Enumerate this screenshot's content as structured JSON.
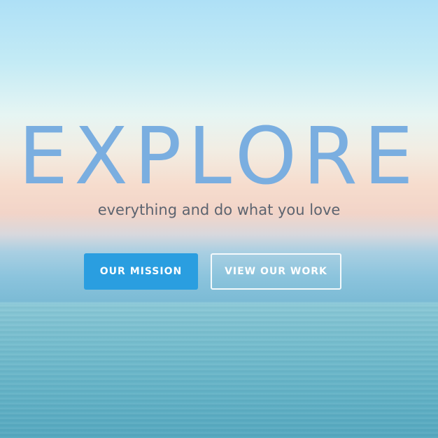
{
  "hero": {
    "headline": "EXPLORE",
    "tagline": "everything and do what you love",
    "primary_button": "OUR MISSION",
    "secondary_button": "VIEW OUR WORK"
  },
  "colors": {
    "headline": "#7aaee0",
    "tagline": "#5c6470",
    "primary_button_bg": "#2a9ee0",
    "button_text": "#ffffff"
  }
}
